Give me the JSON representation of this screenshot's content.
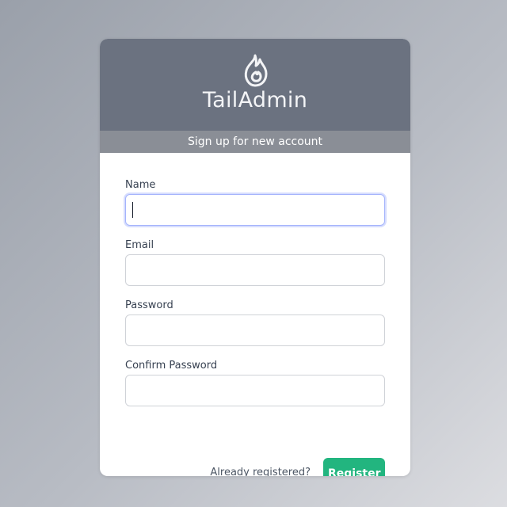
{
  "brand": {
    "name": "TailAdmin",
    "logo_icon": "flame-icon"
  },
  "header": {
    "subtitle": "Sign up for new account"
  },
  "form": {
    "fields": [
      {
        "label": "Name",
        "value": "",
        "type": "text",
        "focused": true
      },
      {
        "label": "Email",
        "value": "",
        "type": "email",
        "focused": false
      },
      {
        "label": "Password",
        "value": "",
        "type": "password",
        "focused": false
      },
      {
        "label": "Confirm Password",
        "value": "",
        "type": "password",
        "focused": false
      }
    ],
    "login_link": "Already registered?",
    "submit_label": "Register"
  },
  "colors": {
    "header_bg": "#6b7280",
    "subtitle_bg": "#8a8e96",
    "accent": "#22b57f",
    "focus_ring": "#a5b4fc"
  }
}
